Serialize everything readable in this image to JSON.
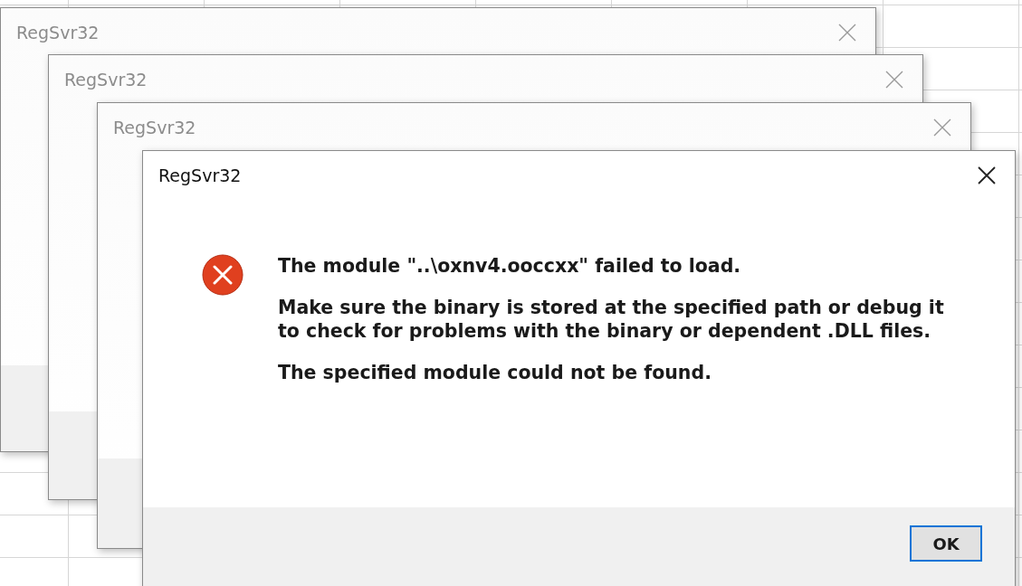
{
  "windows": [
    {
      "title": "RegSvr32",
      "active": false
    },
    {
      "title": "RegSvr32",
      "active": false
    },
    {
      "title": "RegSvr32",
      "active": false
    },
    {
      "title": "RegSvr32",
      "active": true,
      "kind": "error",
      "message": [
        "The module \"..\\oxnv4.ooccxx\" failed to load.",
        "Make sure the binary is stored at the specified path or debug it to check for problems with the binary or dependent .DLL files.",
        "The specified module could not be found."
      ],
      "buttons": [
        "OK"
      ]
    }
  ]
}
